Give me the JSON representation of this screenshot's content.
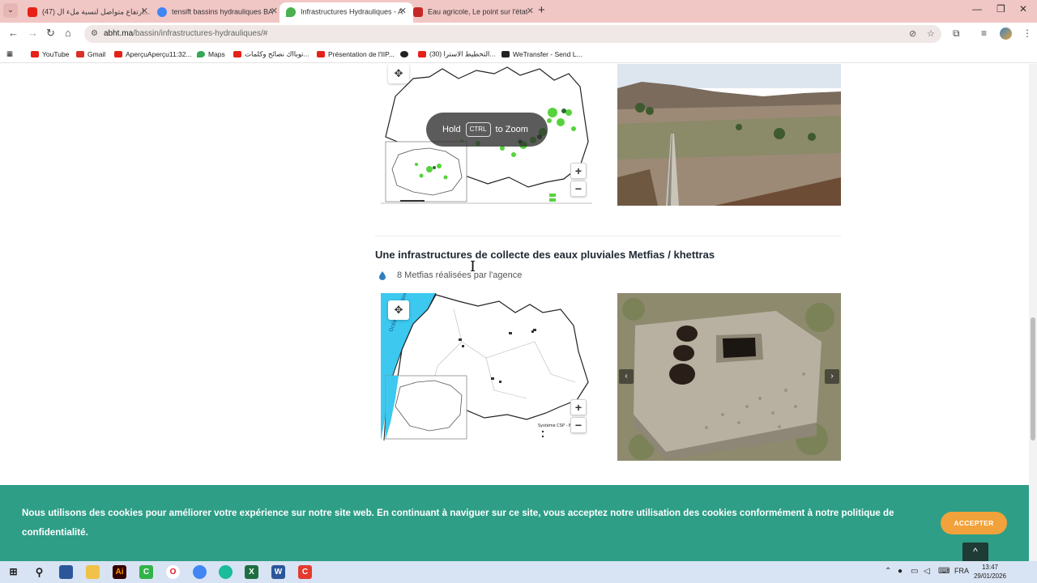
{
  "browser": {
    "tabs": [
      {
        "title": "(47) ارتفاع متواصل لنسبة ملء ال...",
        "favicon_color": "#e62117",
        "active": false
      },
      {
        "title": "tensift bassins hydrauliques BA",
        "favicon_color": "#4285f4",
        "active": false
      },
      {
        "title": "Infrastructures Hydrauliques - A",
        "favicon_color": "#4caf50",
        "active": true
      },
      {
        "title": "Eau agricole, Le point sur l'état",
        "favicon_color": "#c62828",
        "active": false
      }
    ],
    "url_host": "abht.ma",
    "url_path": "/bassin/infrastructures-hydrauliques/#",
    "bookmarks": [
      {
        "label": "YouTube",
        "color": "#e62117"
      },
      {
        "label": "Gmail",
        "color": "#d93025"
      },
      {
        "label": "AperçuAperçu11:32...",
        "color": "#e62117"
      },
      {
        "label": "Maps",
        "color": "#34a853"
      },
      {
        "label": "توبااك نصائح وكلمات...",
        "color": "#e62117"
      },
      {
        "label": "Présentation de l'IIP...",
        "color": "#e62117"
      },
      {
        "label": "",
        "color": "#222222"
      },
      {
        "label": "(30) التخطيط الاسترا...",
        "color": "#e62117"
      },
      {
        "label": "WeTransfer - Send L...",
        "color": "#222222"
      }
    ]
  },
  "page": {
    "hold_zoom": {
      "hold": "Hold",
      "key": "CTRL",
      "to_zoom": "to Zoom"
    },
    "section_title": "Une infrastructures de collecte des eaux pluviales Metfias / khettras",
    "item_text": "8 Metfias réalisées par l'agence",
    "map2_ocean_label": "Océan Atlantique",
    "map2_legend_title": "Système CSP - Ma",
    "zoom_in": "+",
    "zoom_out": "−",
    "move": "✥",
    "carousel_prev": "‹",
    "carousel_next": "›"
  },
  "cookie": {
    "text": "Nous utilisons des cookies pour améliorer votre expérience sur notre site web. En continuant à naviguer sur ce site, vous acceptez notre utilisation des cookies conformément à notre politique de confidentialité.",
    "accept": "ACCEPTER",
    "to_top": "^"
  },
  "taskbar": {
    "lang": "FRA",
    "time": "13:47",
    "date": "29/01/2026"
  },
  "colors": {
    "cookie_bg": "#2e9e87",
    "accept_bg": "#f2a23a",
    "tab_bar": "#f1c7c5",
    "ocean": "#3cc8ef",
    "map_green": "#56d33c"
  }
}
